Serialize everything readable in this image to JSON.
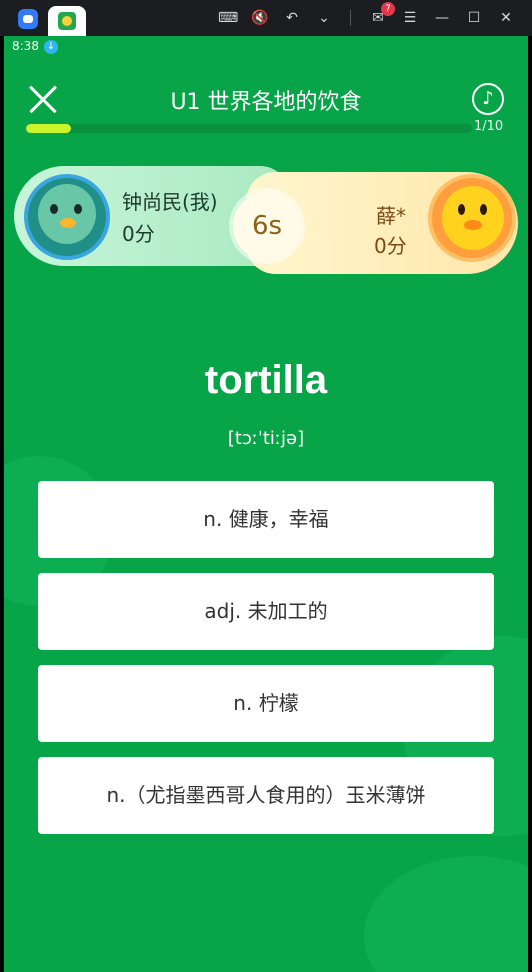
{
  "window": {
    "notification_count": "7",
    "icons": [
      "app-logo",
      "keyboard-icon",
      "mute-icon",
      "undo-icon",
      "chevron-down-icon",
      "mail-icon",
      "menu-icon",
      "minimize-icon",
      "maximize-icon",
      "close-window-icon"
    ]
  },
  "status": {
    "time": "8:38"
  },
  "header": {
    "title": "U1 世界各地的饮食",
    "progress_text": "1/10",
    "progress_fraction": 0.1
  },
  "battle": {
    "me": {
      "name": "钟尚民(我)",
      "score": "0分"
    },
    "opponent": {
      "name": "薛*",
      "score": "0分"
    },
    "timer": "6s"
  },
  "question": {
    "word": "tortilla",
    "phonetic": "[tɔːˈtiːjə]"
  },
  "options": [
    {
      "label": "n. 健康，幸福"
    },
    {
      "label": "adj. 未加工的"
    },
    {
      "label": "n. 柠檬"
    },
    {
      "label": "n.（尤指墨西哥人食用的）玉米薄饼"
    }
  ],
  "colors": {
    "background": "#08a448",
    "progress": "#c9f52a",
    "me_card": "#b6eecb",
    "opponent_card": "#ffefbd"
  }
}
